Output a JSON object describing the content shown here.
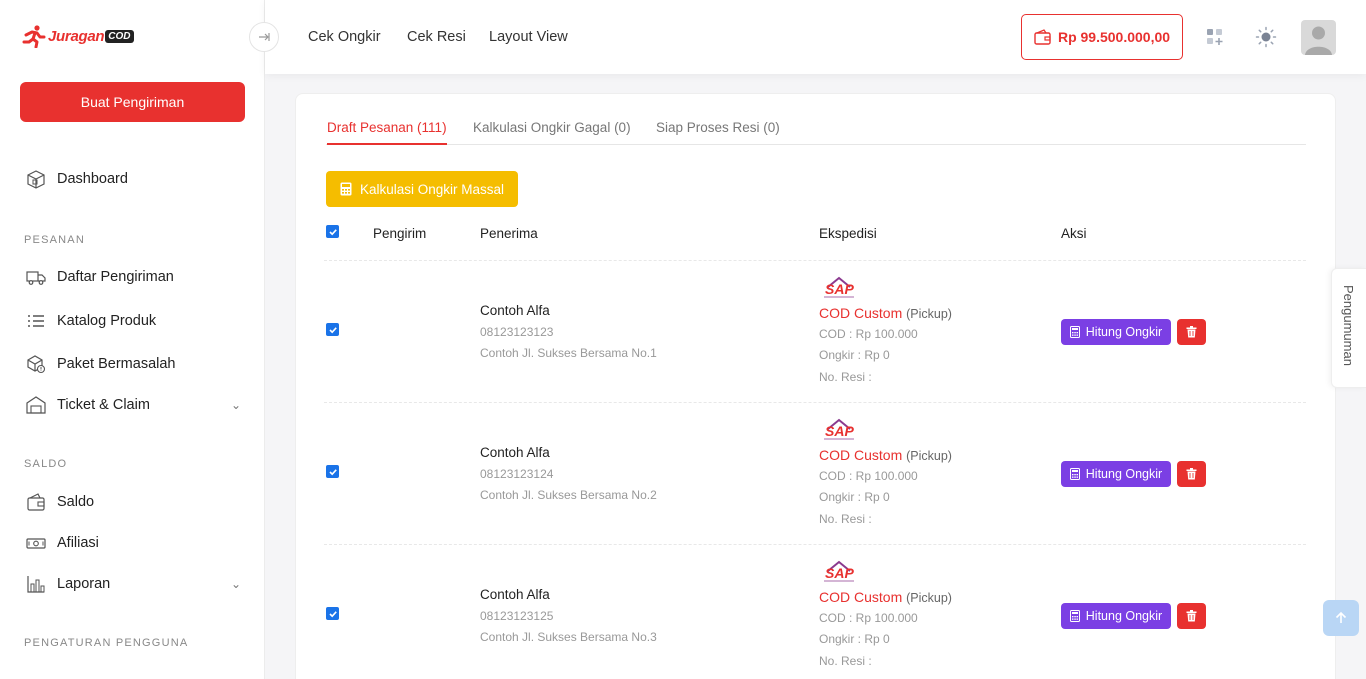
{
  "brand": {
    "name": "Juragan",
    "suffix": "COD"
  },
  "sidebar": {
    "create_button": "Buat Pengiriman",
    "dashboard": "Dashboard",
    "sections": {
      "pesanan": "PESANAN",
      "saldo": "SALDO",
      "pengaturan": "PENGATURAN PENGGUNA"
    },
    "pesanan_items": [
      "Daftar Pengiriman",
      "Katalog Produk",
      "Paket Bermasalah",
      "Ticket & Claim"
    ],
    "saldo_items": [
      "Saldo",
      "Afiliasi",
      "Laporan"
    ]
  },
  "topbar": {
    "nav": [
      "Cek Ongkir",
      "Cek Resi",
      "Layout View"
    ],
    "balance": "Rp 99.500.000,00"
  },
  "tabs": [
    "Draft Pesanan (111)",
    "Kalkulasi Ongkir Gagal (0)",
    "Siap Proses Resi (0)"
  ],
  "mass_button": "Kalkulasi Ongkir Massal",
  "table": {
    "headers": [
      "Pengirim",
      "Penerima",
      "Ekspedisi",
      "Aksi"
    ],
    "rows": [
      {
        "name": "Contoh Alfa",
        "phone": "08123123123",
        "address": "Contoh Jl. Sukses Bersama No.1",
        "courier": "COD Custom",
        "pickup": "(Pickup)",
        "cod": "COD : Rp 100.000",
        "ongkir": "Ongkir : Rp 0",
        "resi": "No. Resi :",
        "action": "Hitung Ongkir"
      },
      {
        "name": "Contoh Alfa",
        "phone": "08123123124",
        "address": "Contoh Jl. Sukses Bersama No.2",
        "courier": "COD Custom",
        "pickup": "(Pickup)",
        "cod": "COD : Rp 100.000",
        "ongkir": "Ongkir : Rp 0",
        "resi": "No. Resi :",
        "action": "Hitung Ongkir"
      },
      {
        "name": "Contoh Alfa",
        "phone": "08123123125",
        "address": "Contoh Jl. Sukses Bersama No.3",
        "courier": "COD Custom",
        "pickup": "(Pickup)",
        "cod": "COD : Rp 100.000",
        "ongkir": "Ongkir : Rp 0",
        "resi": "No. Resi :",
        "action": "Hitung Ongkir"
      }
    ]
  },
  "courier_logo": "SAP",
  "announcement": "Pengumuman",
  "colors": {
    "brand_red": "#e8312f",
    "yellow": "#f5bd00",
    "purple": "#7b3fe4",
    "checkbox_blue": "#1a73e8"
  },
  "icons": [
    "runner-logo-icon",
    "arrow-right-icon",
    "wallet-icon",
    "apps-add-icon",
    "sun-icon",
    "calculator-icon",
    "trash-icon",
    "arrow-up-icon"
  ]
}
